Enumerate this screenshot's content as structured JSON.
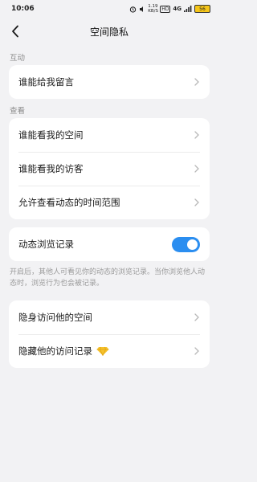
{
  "status": {
    "time": "10:06",
    "network": "1.19 KB/S",
    "hd": "HD",
    "signal": "4G",
    "battery": "56"
  },
  "header": {
    "title": "空间隐私"
  },
  "sections": {
    "interact": {
      "label": "互动",
      "items": [
        {
          "label": "谁能给我留言"
        }
      ]
    },
    "view": {
      "label": "查看",
      "items": [
        {
          "label": "谁能看我的空间"
        },
        {
          "label": "谁能看我的访客"
        },
        {
          "label": "允许查看动态的时间范围"
        }
      ]
    },
    "browse": {
      "label": "动态浏览记录",
      "toggle_on": true,
      "hint": "开启后，其他人可看见你的动态的浏览记录。当你浏览他人动态时，浏览行为也会被记录。"
    },
    "stealth": {
      "items": [
        {
          "label": "隐身访问他的空间"
        },
        {
          "label": "隐藏他的访问记录"
        }
      ]
    }
  },
  "colors": {
    "accent": "#2b8ef0",
    "background": "#f2f2f4",
    "gem": "#f6c22e"
  }
}
